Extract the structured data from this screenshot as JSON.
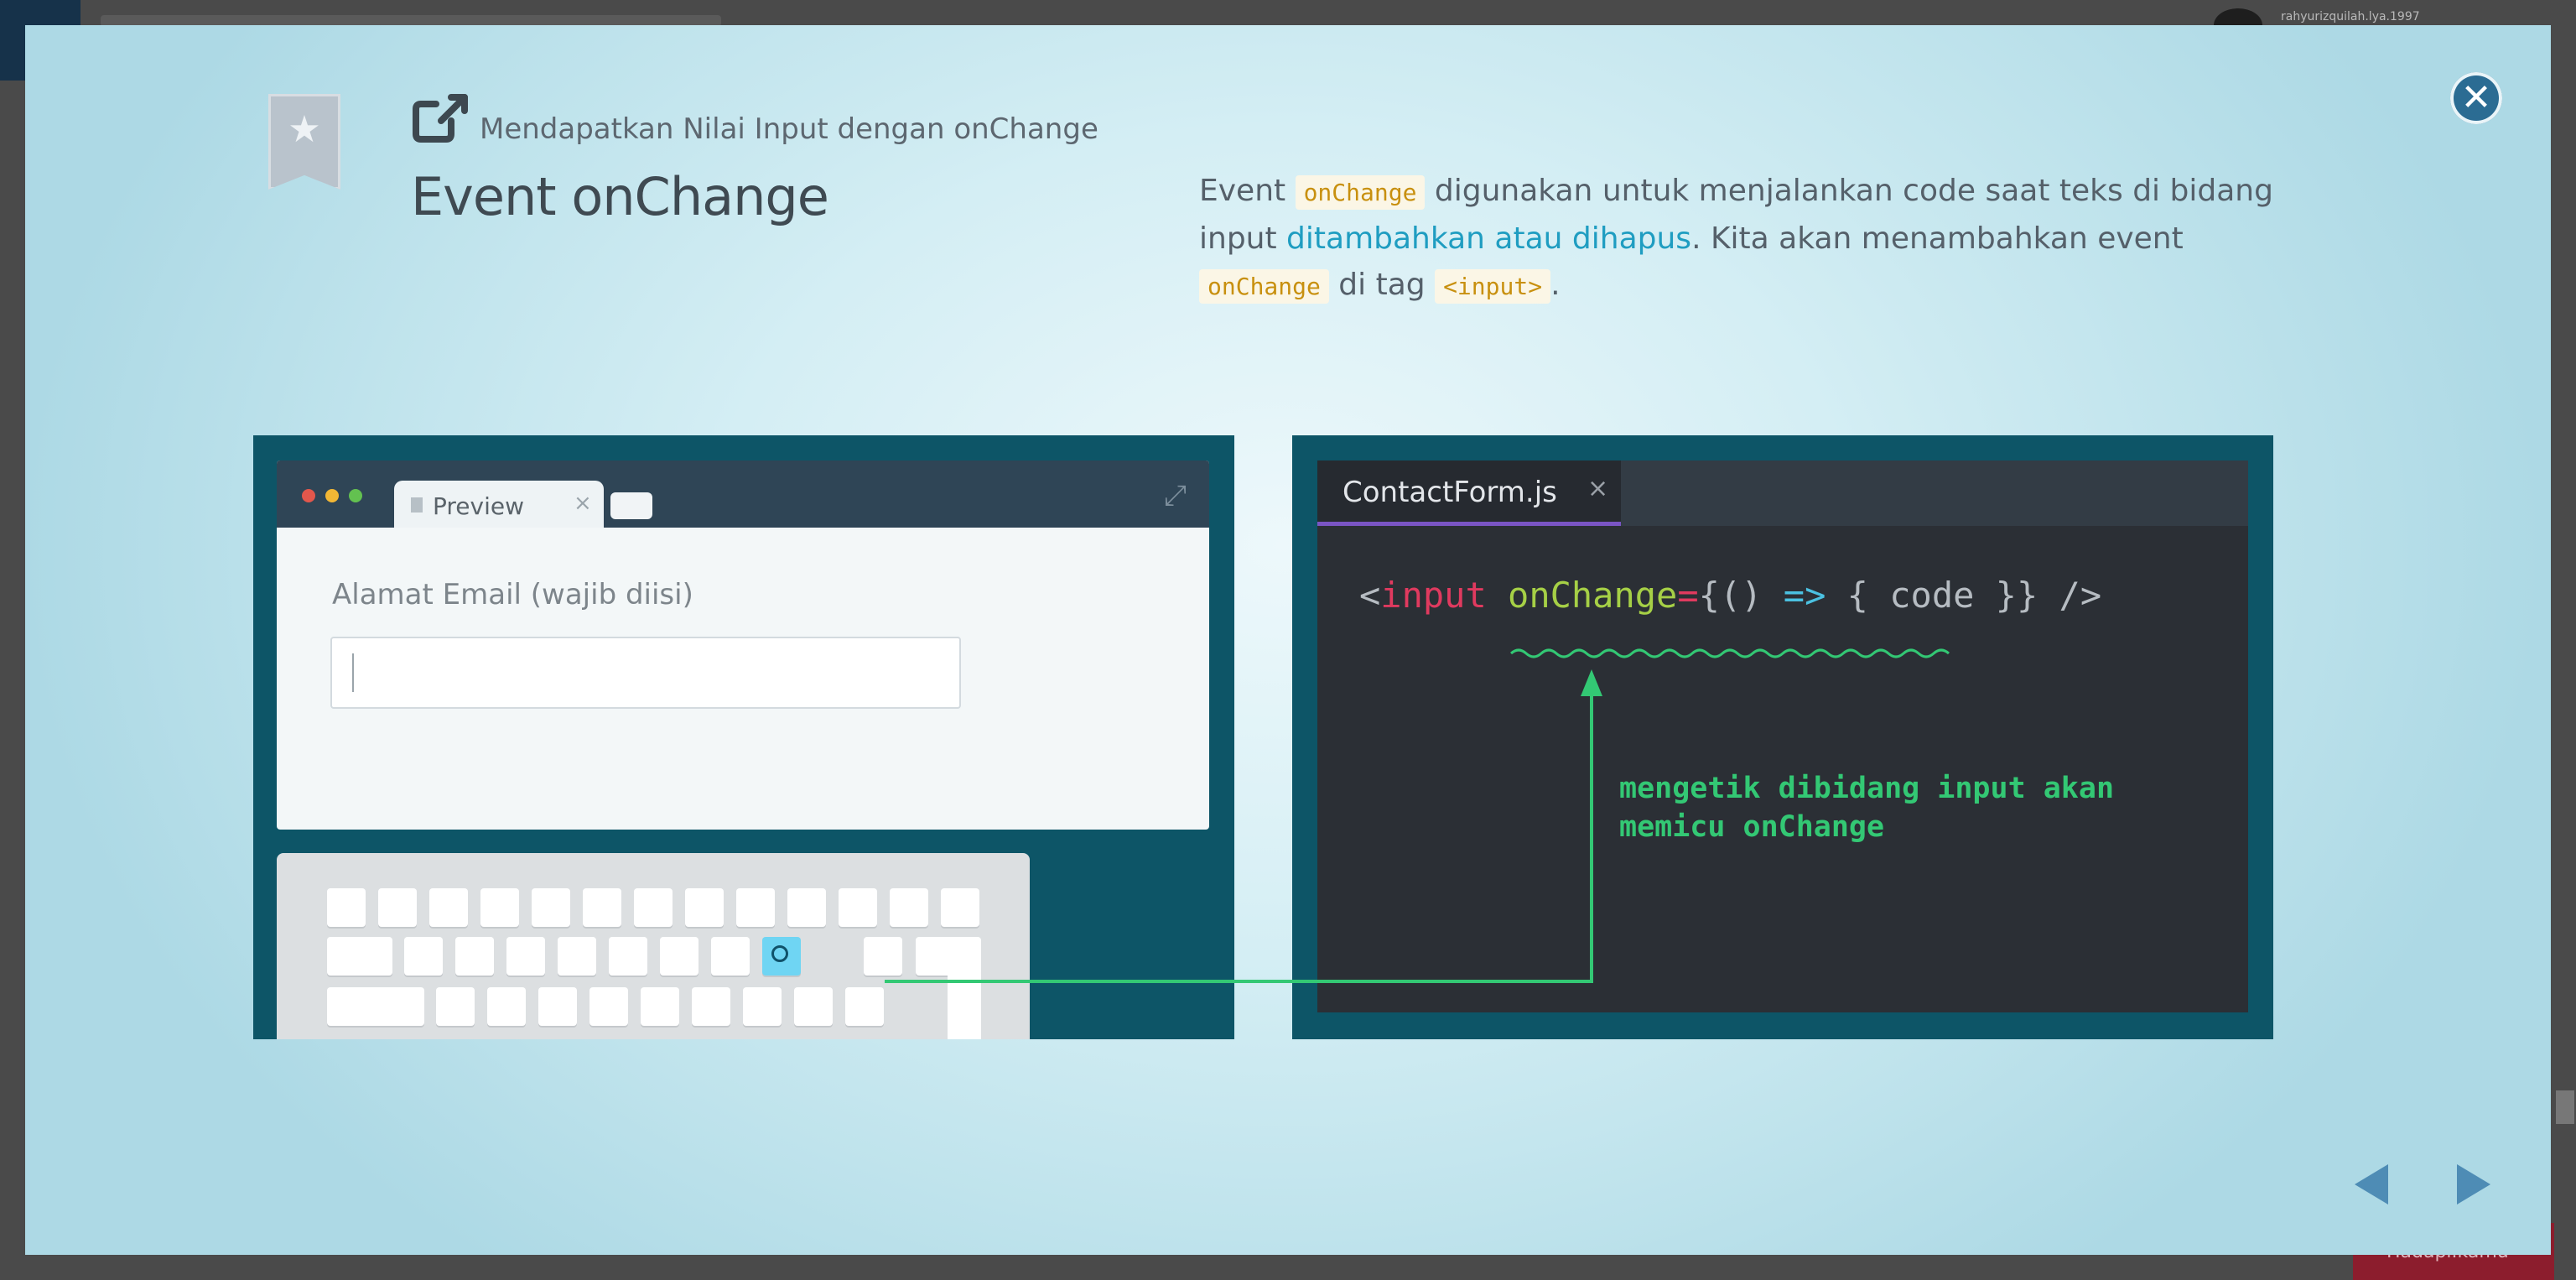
{
  "backdrop": {
    "user": "rahyurizquilah.lya.1997",
    "sidebar_action": "Hadapi.kamu"
  },
  "header": {
    "subtitle": "Mendapatkan Nilai Input dengan onChange",
    "title": "Event onChange"
  },
  "description": {
    "p1": "Event ",
    "chip1": "onChange",
    "p2": " digunakan untuk menjalankan code saat teks di bidang input ",
    "highlight": "ditambahkan atau dihapus",
    "p3": ". Kita akan menambahkan event ",
    "chip2": "onChange",
    "p4": " di tag ",
    "chip3": "<input>",
    "p5": "."
  },
  "preview": {
    "tab_label": "Preview",
    "tab_close": "×",
    "email_label": "Alamat Email (wajib diisi)"
  },
  "editor": {
    "file_name": "ContactForm.js",
    "file_close": "×",
    "code": {
      "open": "<",
      "tag": "input",
      "attr": "onChange",
      "eq": "=",
      "brace": "{",
      "args": "()",
      "arrow": "=>",
      "body": "{ code }",
      "close": "} />"
    },
    "annotation_line1": "mengetik dibidang input akan",
    "annotation_line2": "memicu onChange"
  },
  "icons": {
    "bookmark": "bookmark-star-icon",
    "external_link": "external-link-icon",
    "close": "close-icon",
    "prev": "prev-arrow-icon",
    "next": "next-arrow-icon",
    "expand": "expand-icon"
  },
  "colors": {
    "chip_text": "#c8900f",
    "highlight": "#1f9dc1",
    "panel_bg": "#0d5567",
    "close_button": "#2b6c93",
    "annotation": "#33c874"
  }
}
